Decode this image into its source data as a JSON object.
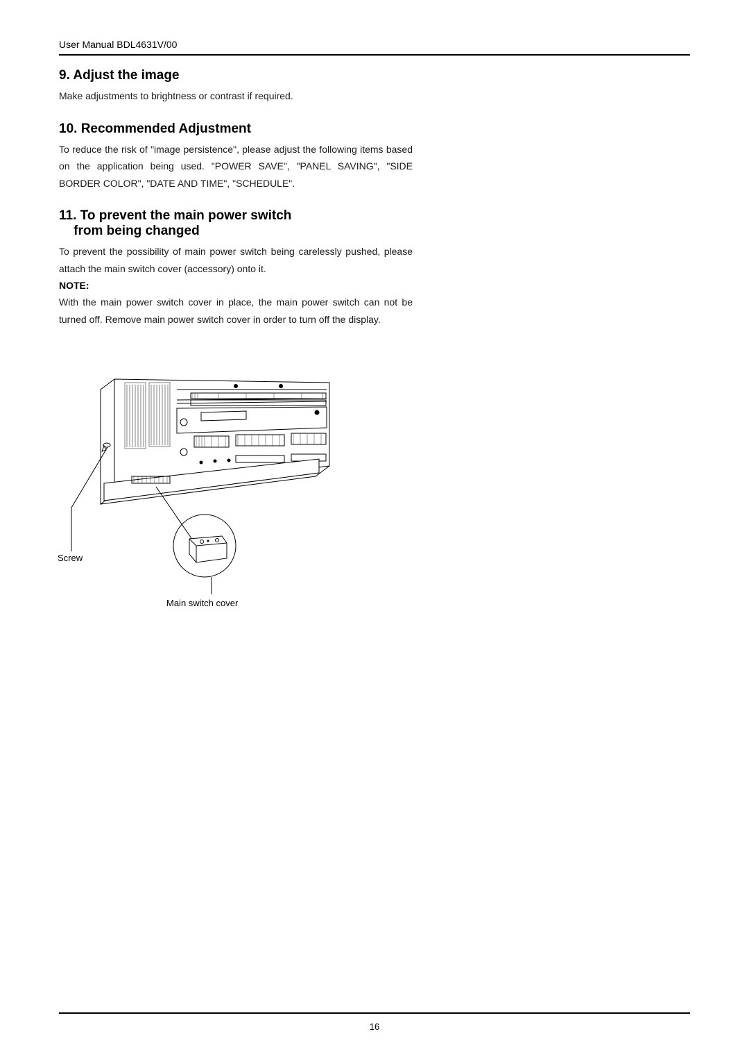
{
  "header": {
    "prefix": "User Manual ",
    "model": "BDL4631V/00"
  },
  "sections": {
    "s9": {
      "title": "9. Adjust the image",
      "body": "Make adjustments to brightness or contrast if required."
    },
    "s10": {
      "title": "10. Recommended Adjustment",
      "body": "To reduce the risk of \"image persistence\", please adjust the following items based on the application being used. \"POWER SAVE\", \"PANEL SAVING\", \"SIDE BORDER COLOR\", \"DATE AND TIME\", \"SCHEDULE\"."
    },
    "s11": {
      "title_l1": "11. To prevent the main power switch",
      "title_l2": "from being changed",
      "body1": "To prevent the possibility of main power switch being carelessly pushed, please attach the main switch cover (accessory) onto it.",
      "note_label": "NOTE:",
      "body2": "With the main power switch cover in place, the main power switch can not be turned off. Remove main power switch cover in order to turn off the display."
    }
  },
  "diagram": {
    "screw_label": "Screw",
    "cover_label": "Main switch cover"
  },
  "footer": {
    "page": "16"
  }
}
